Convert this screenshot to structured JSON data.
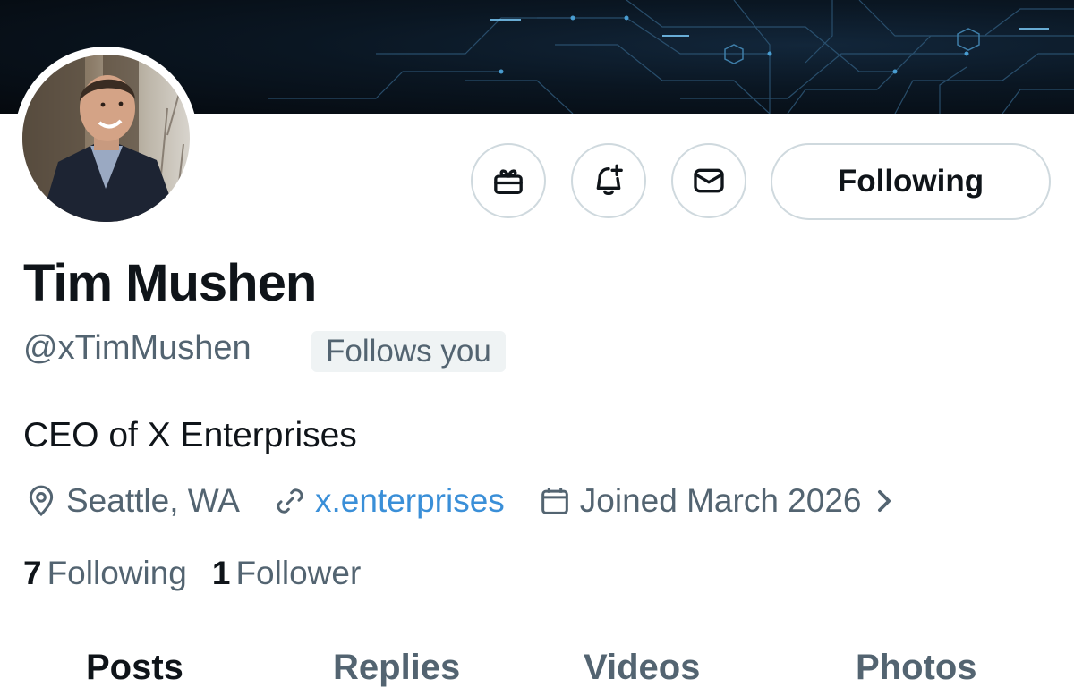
{
  "profile": {
    "display_name": "Tim Mushen",
    "handle": "@xTimMushen",
    "follows_you_badge": "Follows you",
    "bio": "CEO of X Enterprises",
    "location": "Seattle, WA",
    "website": "x.enterprises",
    "joined": "Joined March 2026",
    "following_count": "7",
    "following_label": "Following",
    "followers_count": "1",
    "followers_label": "Follower"
  },
  "actions": {
    "follow_state_label": "Following",
    "gift_icon": "gift-icon",
    "notify_icon": "bell-plus-icon",
    "message_icon": "mail-icon"
  },
  "tabs": [
    {
      "label": "Posts"
    },
    {
      "label": "Replies"
    },
    {
      "label": "Videos"
    },
    {
      "label": "Photos"
    }
  ],
  "colors": {
    "text_primary": "#0f1419",
    "text_secondary": "#536471",
    "link": "#3a8fd8",
    "border": "#cfd9de",
    "badge_bg": "#eff3f4"
  }
}
